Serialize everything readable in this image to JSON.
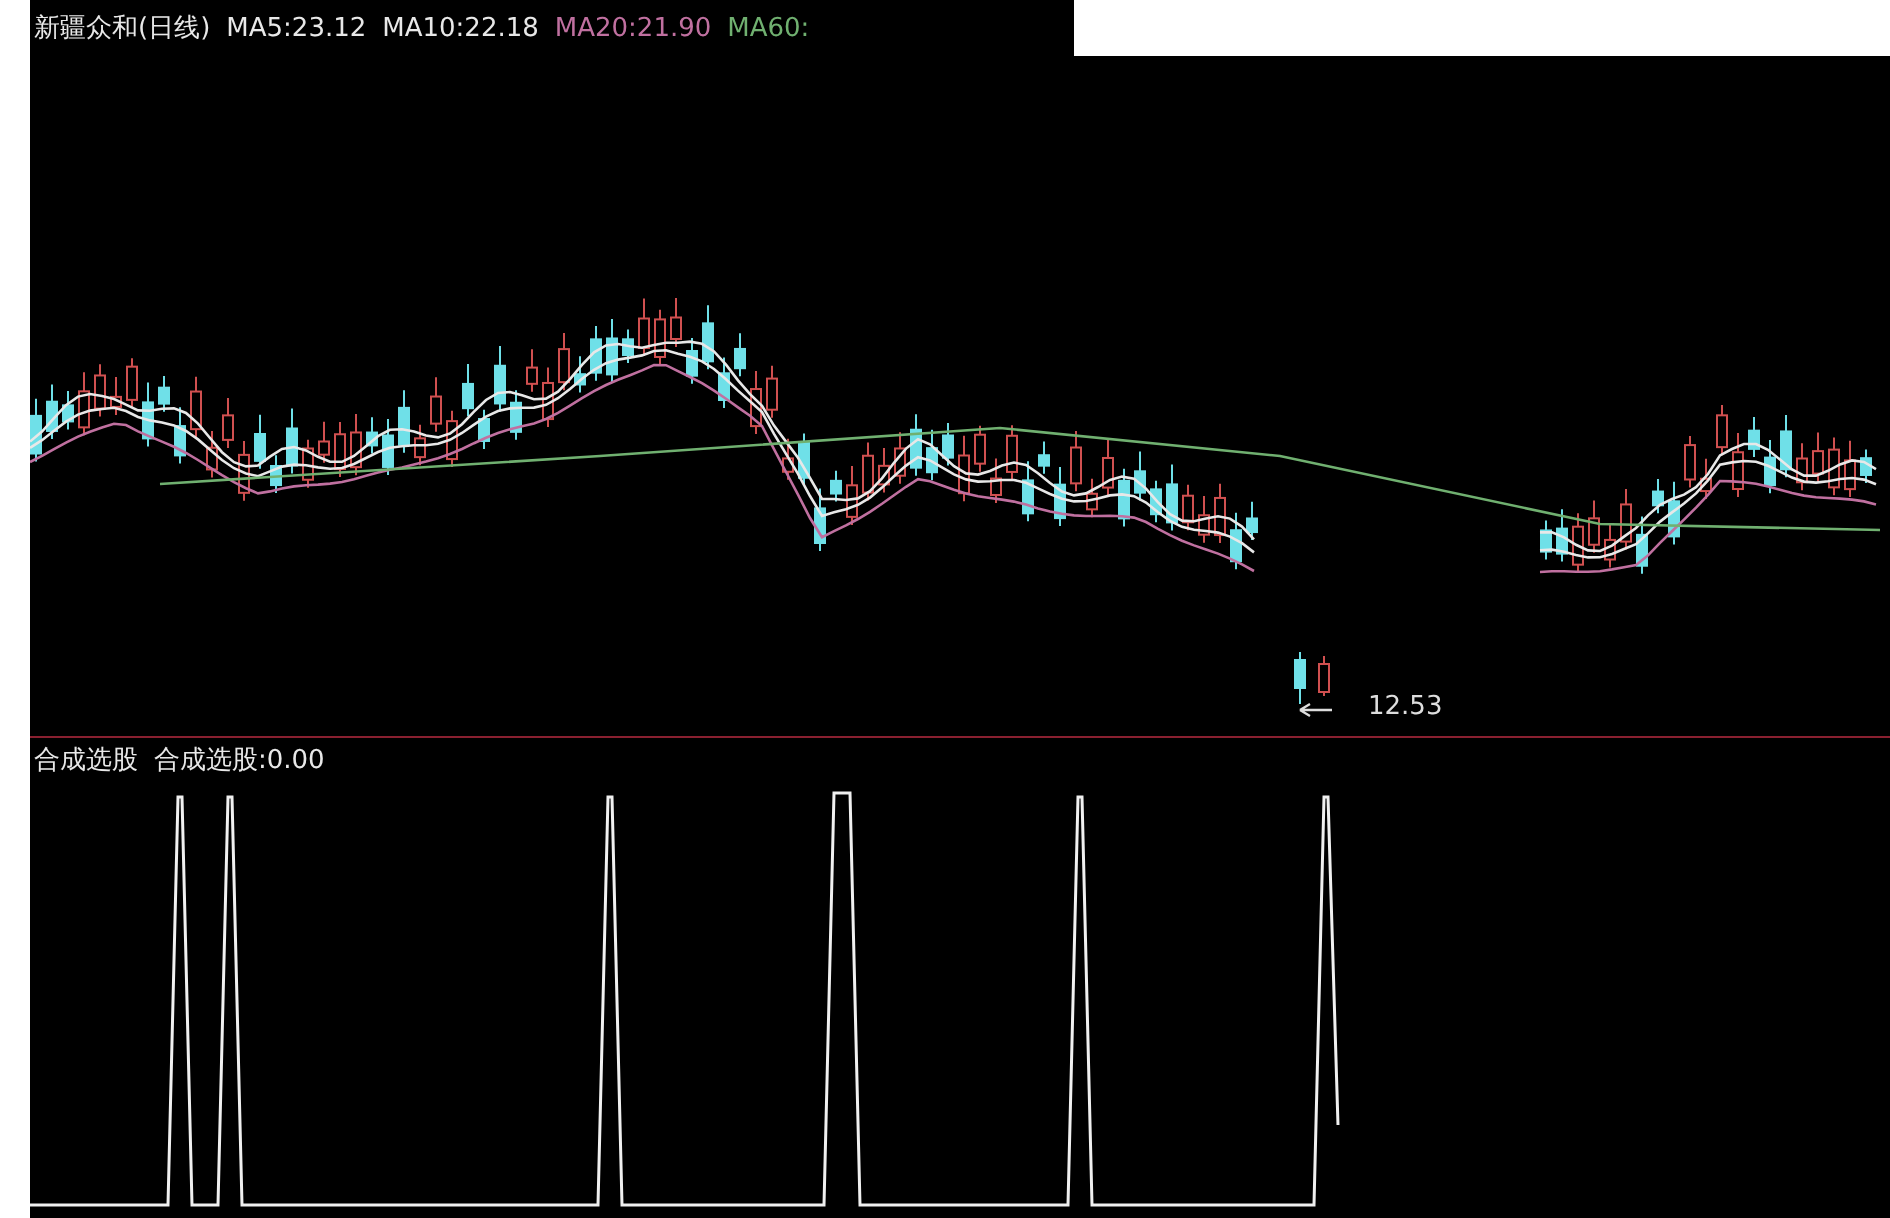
{
  "header": {
    "title": "新疆众和(日线)",
    "ma": [
      {
        "label": "MA5:23.12",
        "color": "#e8e8e8"
      },
      {
        "label": "MA10:22.18",
        "color": "#e8e8e8"
      },
      {
        "label": "MA20:21.90",
        "color": "#c070a0"
      },
      {
        "label": "MA60:",
        "color": "#70b070"
      }
    ]
  },
  "price_marker": {
    "value": "12.53"
  },
  "indicator": {
    "name": "合成选股",
    "reading": "合成选股:0.00"
  }
}
